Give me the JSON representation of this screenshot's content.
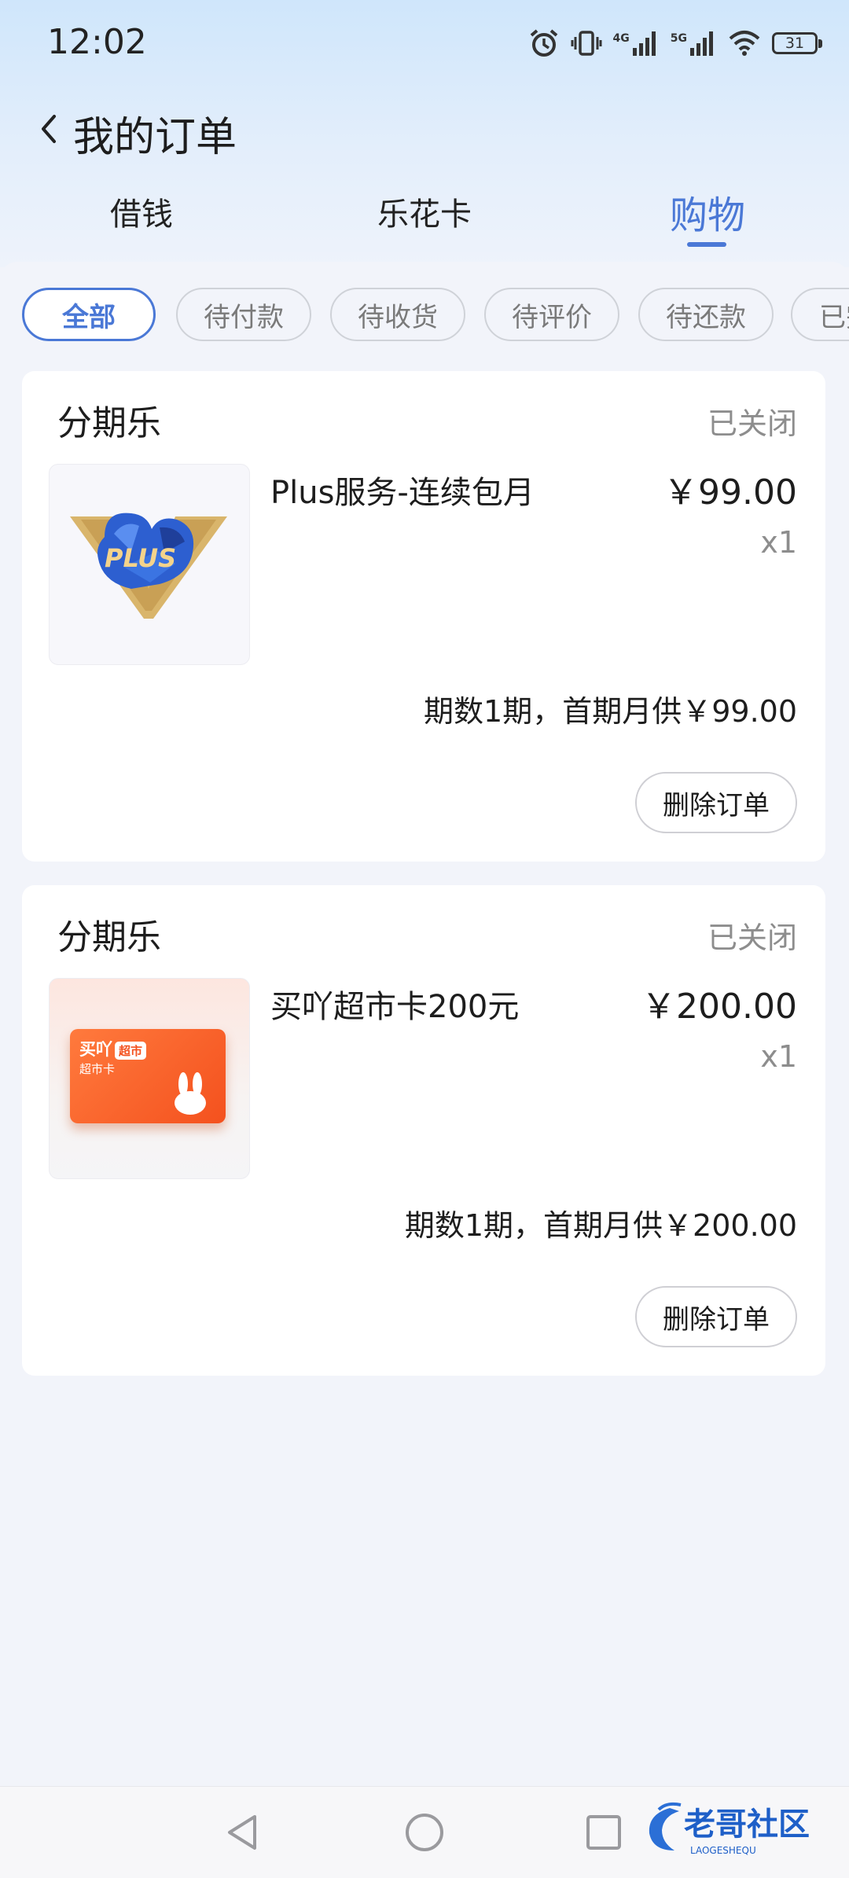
{
  "status_bar": {
    "time": "12:02",
    "net1": "4G",
    "net2": "5G",
    "battery": "31",
    "icons": [
      "alarm-icon",
      "vibrate-icon",
      "signal-icon",
      "signal-icon",
      "wifi-icon",
      "battery-icon"
    ]
  },
  "header": {
    "title": "我的订单",
    "back_icon": "chevron-left-icon"
  },
  "tabs": [
    {
      "label": "借钱",
      "active": false
    },
    {
      "label": "乐花卡",
      "active": false
    },
    {
      "label": "购物",
      "active": true
    }
  ],
  "filters": [
    {
      "label": "全部",
      "active": true
    },
    {
      "label": "待付款",
      "active": false
    },
    {
      "label": "待收货",
      "active": false
    },
    {
      "label": "待评价",
      "active": false
    },
    {
      "label": "待还款",
      "active": false
    },
    {
      "label": "已完",
      "active": false
    }
  ],
  "orders": [
    {
      "merchant": "分期乐",
      "status": "已关闭",
      "product_name": "Plus服务-连续包月",
      "price": "￥99.00",
      "qty": "x1",
      "installment": "期数1期，首期月供￥99.00",
      "delete_label": "删除订单",
      "thumb_text": "PLUS"
    },
    {
      "merchant": "分期乐",
      "status": "已关闭",
      "product_name": "买吖超市卡200元",
      "price": "￥200.00",
      "qty": "x1",
      "installment": "期数1期，首期月供￥200.00",
      "delete_label": "删除订单",
      "thumb_brand": "买吖",
      "thumb_tag": "超市",
      "thumb_sub": "超市卡"
    }
  ],
  "nav": {
    "icons": [
      "back-nav-icon",
      "home-nav-icon",
      "recents-nav-icon"
    ]
  },
  "watermark": {
    "text": "老哥社区",
    "subtext": "LAOGESHEQU"
  },
  "colors": {
    "accent": "#4a78d6",
    "background": "#f2f4fa",
    "card": "#ffffff",
    "muted": "#8d8d8d"
  }
}
